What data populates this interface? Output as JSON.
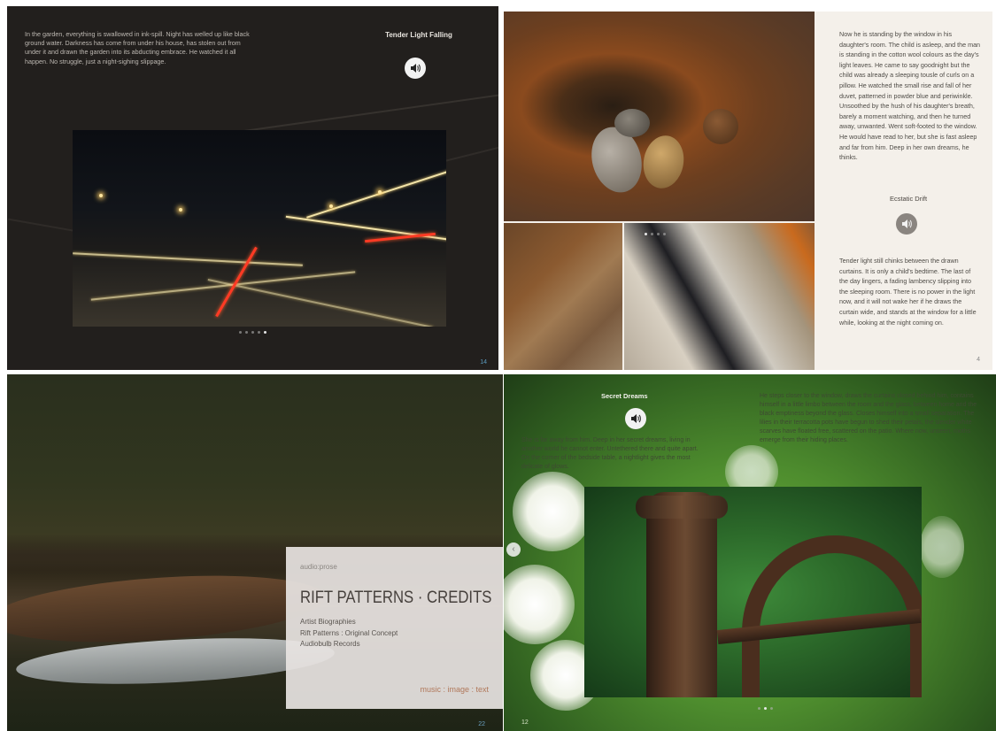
{
  "panels": {
    "tender_light": {
      "prose": "In the garden, everything is swallowed in ink-spill. Night has welled up like black ground water. Darkness has come from under his house, has stolen out from under it and drawn the garden into its abducting embrace. He watched it all happen. No struggle, just a night-sighing slippage.",
      "title": "Tender Light Falling",
      "page_number": "14",
      "icon": "speaker-icon",
      "page_dots": 5,
      "active_dot": 4
    },
    "ecstatic_drift": {
      "prose_top": "Now he is standing by the window in his daughter's room. The child is asleep, and the man is standing in the cotton wool colours as the day's light leaves. He came to say goodnight but the child was already a sleeping tousle of curls on a pillow. He watched the small rise and fall of her duvet, patterned in powder blue and periwinkle. Unsoothed by the hush of his daughter's breath, barely a moment watching, and then he turned away, unwanted. Went soft-footed to the window. He would have read to her, but she is fast asleep and far from him. Deep in her own dreams, he thinks.",
      "title": "Ecstatic Drift",
      "prose_bottom": "Tender light still chinks between the drawn curtains. It is only a child's bedtime. The last of the day lingers, a fading lambency slipping into the sleeping room. There is no power in the light now, and it will not wake her if he draws the curtain wide, and stands at the window for a little while, looking at the night coming on.",
      "page_number": "4",
      "icon": "speaker-icon",
      "page_dots": 4,
      "active_dot": 0
    },
    "credits": {
      "subtitle": "audio:prose",
      "title": "RIFT PATTERNS · CREDITS",
      "links": [
        "Artist Biographies",
        "Rift Patterns : Original Concept",
        "Audiobulb Records"
      ],
      "media_line": "music : image : text",
      "page_number": "22"
    },
    "secret_dreams": {
      "title": "Secret Dreams",
      "prose_left": "She is far away from him. Deep in her secret dreams, living in another world he cannot enter. Untethered there and quite apart. On the corner of the bedside table, a nightlight gives the most delicate of glows.",
      "prose_right": "He steps closer to the window, draws the curtains closed behind him, contains himself in a little limbo between the room and the glass, between home and the black emptiness beyond the glass. Closes himself into a small separation. The lilies in their terracotta pots have begun to shed their petals, the slender white scarves have floated free, scattered on the patio. Where now, unseen, moths emerge from their hiding places.",
      "page_number": "12",
      "icon": "speaker-icon",
      "nav_icon": "chevron-left-icon",
      "page_dots": 3,
      "active_dot": 1
    }
  },
  "colors": {
    "dark_bg": "#221f1d",
    "page_number_blue": "#5b9bc0",
    "cream_bg": "#f4f0ea",
    "credit_accent": "#b0785a"
  }
}
